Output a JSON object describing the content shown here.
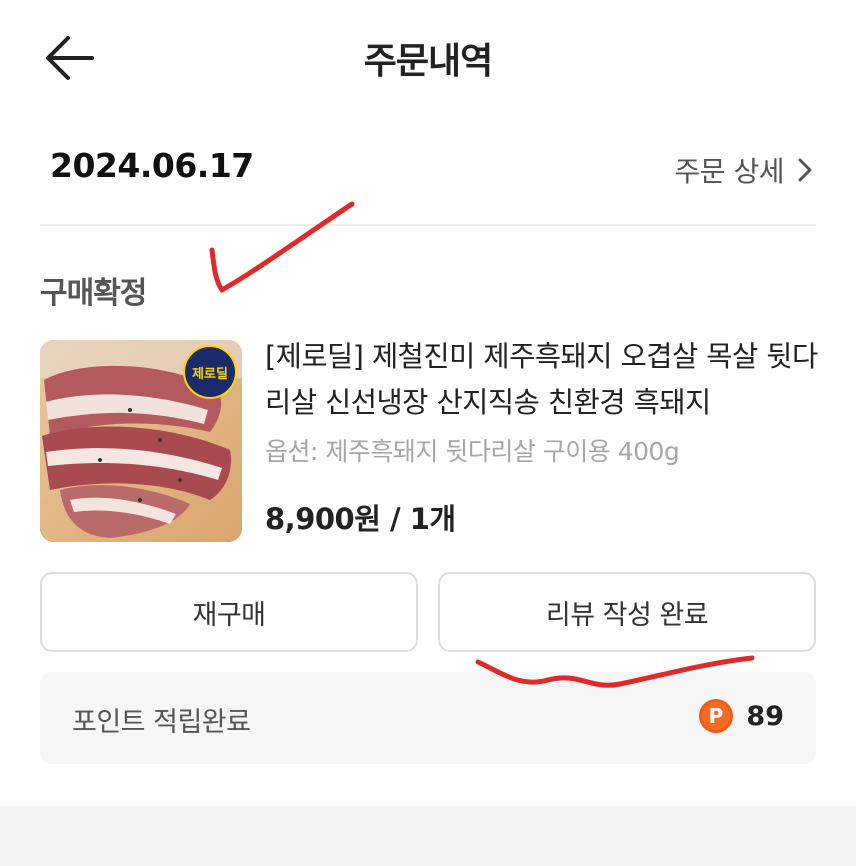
{
  "header": {
    "title": "주문내역"
  },
  "order": {
    "date": "2024.06.17",
    "detail_link": "주문 상세",
    "status": "구매확정",
    "product": {
      "thumbnail_badge": "제로딜",
      "name": "[제로딜] 제철진미 제주흑돼지 오겹살 목살 뒷다리살 신선냉장 산지직송 친환경 흑돼지",
      "option": "옵션: 제주흑돼지 뒷다리살 구이용 400g",
      "price": "8,900원 / 1개"
    },
    "actions": {
      "rebuy": "재구매",
      "review": "리뷰 작성 완료"
    },
    "points": {
      "label": "포인트 적립완료",
      "icon_letter": "P",
      "value": "89"
    }
  },
  "colors": {
    "annotation_red": "#e02a2a",
    "point_icon": "#f05a1a"
  },
  "icons": {
    "back": "arrow-left-icon",
    "detail": "chevron-right-icon",
    "points": "point-coin-icon"
  }
}
